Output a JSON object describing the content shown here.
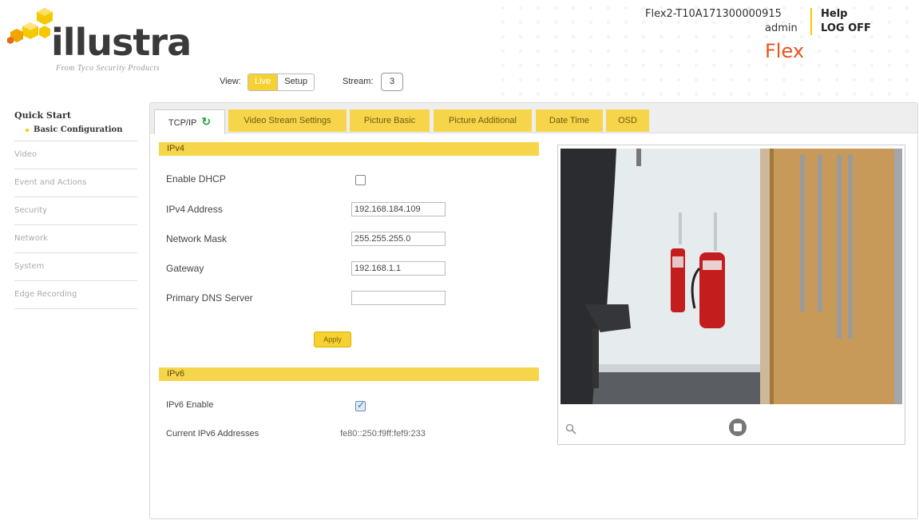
{
  "header": {
    "logo_text": "illustra",
    "logo_subtitle": "From Tyco Security Products",
    "device_name": "Flex2-T10A171300000915",
    "user": "admin",
    "help_label": "Help",
    "logoff_label": "LOG OFF",
    "model": "Flex",
    "accent_color": "#f5c800",
    "model_color": "#e8541d"
  },
  "toolbar": {
    "view_label": "View:",
    "view_options": [
      "Live",
      "Setup"
    ],
    "view_selected": "Live",
    "stream_label": "Stream:",
    "stream_value": "3"
  },
  "sidebar": {
    "title": "Quick Start",
    "subitem": "Basic Configuration",
    "items": [
      "Video",
      "Event and Actions",
      "Security",
      "Network",
      "System",
      "Edge Recording"
    ]
  },
  "tabs": [
    {
      "label": "TCP/IP",
      "active": true
    },
    {
      "label": "Video Stream Settings"
    },
    {
      "label": "Picture Basic"
    },
    {
      "label": "Picture Additional"
    },
    {
      "label": "Date Time"
    },
    {
      "label": "OSD"
    }
  ],
  "ipv4": {
    "section_title": "IPv4",
    "enable_dhcp_label": "Enable DHCP",
    "enable_dhcp_checked": false,
    "address_label": "IPv4 Address",
    "address_value": "192.168.184.109",
    "mask_label": "Network Mask",
    "mask_value": "255.255.255.0",
    "gateway_label": "Gateway",
    "gateway_value": "192.168.1.1",
    "dns_label": "Primary DNS Server",
    "dns_value": "",
    "apply_label": "Apply"
  },
  "ipv6": {
    "section_title": "IPv6",
    "enable_label": "IPv6 Enable",
    "enable_checked": true,
    "addresses_label": "Current IPv6 Addresses",
    "addresses_value": "fe80::250:f9ff:fef9:233"
  },
  "video": {
    "zoom_icon": "zoom-icon",
    "stop_icon": "stop-icon"
  }
}
